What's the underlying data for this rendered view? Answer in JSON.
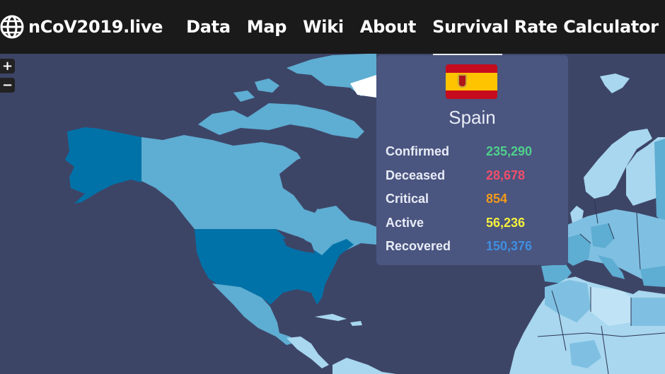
{
  "navbar": {
    "brand_icon": "globe-icon",
    "brand": "nCoV2019.live",
    "items": [
      {
        "label": "Data"
      },
      {
        "label": "Map"
      },
      {
        "label": "Wiki"
      },
      {
        "label": "About"
      },
      {
        "label": "Survival Rate Calculator"
      }
    ]
  },
  "map": {
    "zoom_in_label": "+",
    "zoom_out_label": "−",
    "colors": {
      "ocean": "#3d4567",
      "high": "#0072a8",
      "medium": "#5eadd2",
      "light": "#a8d7ef",
      "lightest": "#c0e4f6"
    }
  },
  "tooltip": {
    "flag_icon": "spain-flag-icon",
    "country": "Spain",
    "stats": [
      {
        "label": "Confirmed",
        "value": "235,290",
        "color": "#4fd18b"
      },
      {
        "label": "Deceased",
        "value": "28,678",
        "color": "#ef4f6a"
      },
      {
        "label": "Critical",
        "value": "854",
        "color": "#f29a1a"
      },
      {
        "label": "Active",
        "value": "56,236",
        "color": "#f5f03c"
      },
      {
        "label": "Recovered",
        "value": "150,376",
        "color": "#3f8fe0"
      }
    ]
  }
}
